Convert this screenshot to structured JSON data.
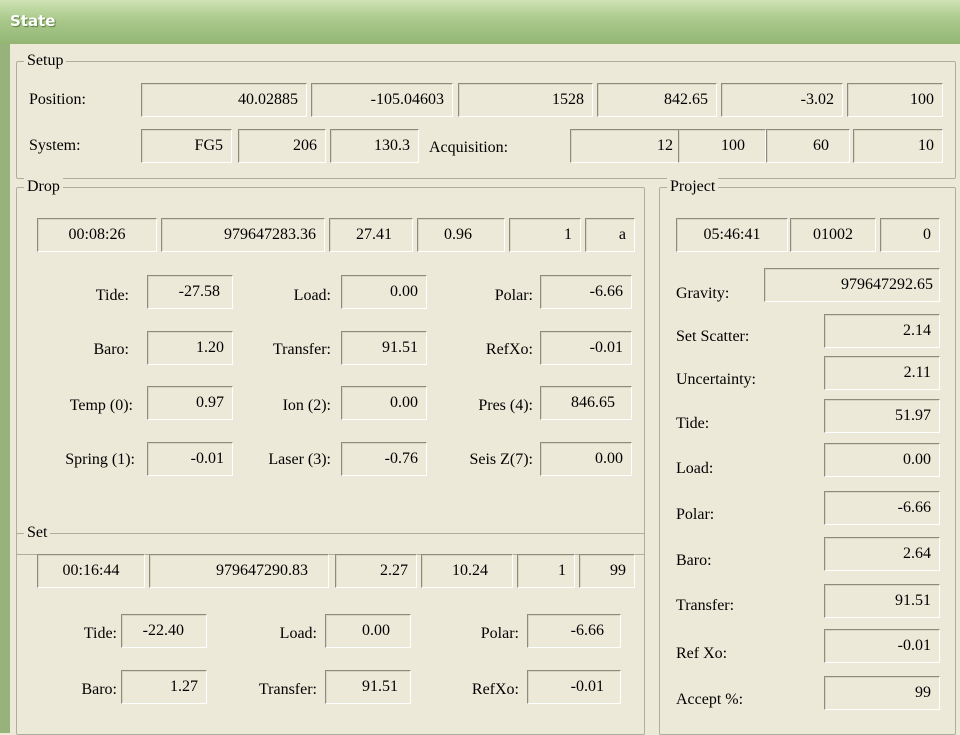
{
  "window": {
    "title": "State"
  },
  "setup": {
    "legend": "Setup",
    "position_label": "Position:",
    "position": [
      "40.02885",
      "-105.04603",
      "1528",
      "842.65",
      "-3.02",
      "100"
    ],
    "system_label": "System:",
    "system": [
      "FG5",
      "206",
      "130.3"
    ],
    "acquisition_label": "Acquisition:",
    "acquisition": [
      "12",
      "100",
      "60",
      "10"
    ]
  },
  "drop": {
    "legend": "Drop",
    "time": "00:08:26",
    "gravity": "979647283.36",
    "f1": "27.41",
    "f2": "0.96",
    "f3": "1",
    "f4": "a",
    "tide_label": "Tide:",
    "tide": "-27.58",
    "load_label": "Load:",
    "load": "0.00",
    "polar_label": "Polar:",
    "polar": "-6.66",
    "baro_label": "Baro:",
    "baro": "1.20",
    "transfer_label": "Transfer:",
    "transfer": "91.51",
    "refxo_label": "RefXo:",
    "refxo": "-0.01",
    "temp_label": "Temp (0):",
    "temp": "0.97",
    "ion_label": "Ion (2):",
    "ion": "0.00",
    "pres_label": "Pres (4):",
    "pres": "846.65",
    "spring_label": "Spring (1):",
    "spring": "-0.01",
    "laser_label": "Laser (3):",
    "laser": "-0.76",
    "seis_label": "Seis Z(7):",
    "seis": "0.00"
  },
  "set": {
    "legend": "Set",
    "time": "00:16:44",
    "gravity": "979647290.83",
    "f1": "2.27",
    "f2": "10.24",
    "f3": "1",
    "f4": "99",
    "tide_label": "Tide:",
    "tide": "-22.40",
    "load_label": "Load:",
    "load": "0.00",
    "polar_label": "Polar:",
    "polar": "-6.66",
    "baro_label": "Baro:",
    "baro": "1.27",
    "transfer_label": "Transfer:",
    "transfer": "91.51",
    "refxo_label": "RefXo:",
    "refxo": "-0.01"
  },
  "project": {
    "legend": "Project",
    "time": "05:46:41",
    "id": "01002",
    "count": "0",
    "gravity_label": "Gravity:",
    "gravity": "979647292.65",
    "set_scatter_label": "Set Scatter:",
    "set_scatter": "2.14",
    "uncertainty_label": "Uncertainty:",
    "uncertainty": "2.11",
    "tide_label": "Tide:",
    "tide": "51.97",
    "load_label": "Load:",
    "load": "0.00",
    "polar_label": "Polar:",
    "polar": "-6.66",
    "baro_label": "Baro:",
    "baro": "2.64",
    "transfer_label": "Transfer:",
    "transfer": "91.51",
    "refxo_label": "Ref Xo:",
    "refxo": "-0.01",
    "accept_label": "Accept %:",
    "accept": "99"
  }
}
